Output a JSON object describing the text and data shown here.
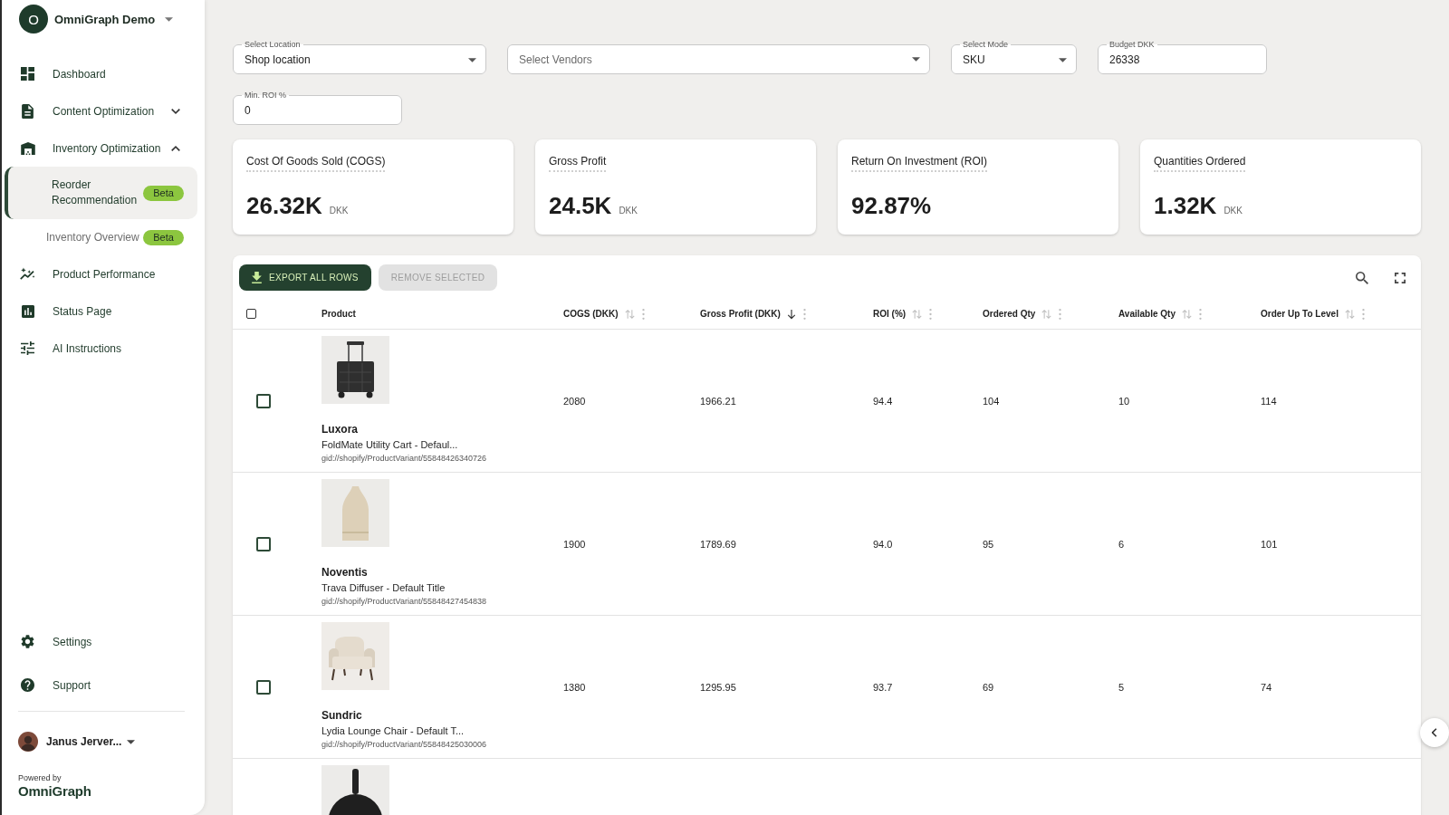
{
  "sidebar": {
    "account": {
      "initial": "O",
      "name": "OmniGraph Demo"
    },
    "nav": [
      {
        "label": "Dashboard",
        "selected": false
      },
      {
        "label": "Content Optimization",
        "selected": false,
        "expanded": false
      },
      {
        "label": "Inventory Optimization",
        "selected": false,
        "expanded": true,
        "children": [
          {
            "label": "Reorder Recommendation",
            "selected": true,
            "badge": "Beta"
          },
          {
            "label": "Inventory Overview",
            "selected": false,
            "badge": "Beta"
          }
        ]
      },
      {
        "label": "Product Performance",
        "selected": false
      },
      {
        "label": "Status Page",
        "selected": false
      },
      {
        "label": "AI Instructions",
        "selected": false
      }
    ],
    "footer_nav": [
      {
        "label": "Settings",
        "selected": false
      },
      {
        "label": "Support",
        "selected": false
      }
    ],
    "user": {
      "name": "Janus Jerver..."
    },
    "powered_by": {
      "label": "Powered by",
      "logo": "OmniGraph"
    }
  },
  "filters": [
    {
      "kind": "select",
      "label": "Select Location",
      "value": "Shop location"
    },
    {
      "kind": "select",
      "placeholder": "Select Vendors"
    },
    {
      "kind": "select",
      "label": "Select Mode",
      "value": "SKU"
    },
    {
      "kind": "input",
      "label": "Budget DKK",
      "value": "26338"
    },
    {
      "kind": "input",
      "label": "Min. ROI %",
      "value": "0"
    }
  ],
  "kpis": [
    {
      "label": "Cost Of Goods Sold (COGS)",
      "value": "26.32K",
      "unit": "DKK"
    },
    {
      "label": "Gross Profit",
      "value": "24.5K",
      "unit": "DKK"
    },
    {
      "label": "Return On Investment (ROI)",
      "value": "92.87%"
    },
    {
      "label": "Quantities Ordered",
      "value": "1.32K",
      "unit": "DKK"
    }
  ],
  "table": {
    "buttons": [
      {
        "kind": "export",
        "label": "EXPORT ALL ROWS",
        "disabled": false
      },
      {
        "kind": "remove",
        "label": "REMOVE SELECTED",
        "disabled": true
      }
    ],
    "select_all": {
      "checked": false
    },
    "columns": [
      {
        "label": "Product"
      },
      {
        "label": "COGS (DKK)",
        "sorted": false
      },
      {
        "label": "Gross Profit (DKK)",
        "sorted": true
      },
      {
        "label": "ROI (%)",
        "sorted": false
      },
      {
        "label": "Ordered Qty",
        "sorted": false
      },
      {
        "label": "Available Qty",
        "sorted": false
      },
      {
        "label": "Order Up To Level",
        "sorted": false
      }
    ],
    "rows": [
      {
        "checked": false,
        "image": {
          "kind": "cart"
        },
        "brand": "Luxora",
        "title": "FoldMate Utility Cart - Defaul...",
        "gid": "gid://shopify/ProductVariant/55848426340726",
        "cells": [
          "2080",
          "1966.21",
          "94.4",
          "104",
          "10",
          "114"
        ]
      },
      {
        "checked": false,
        "image": {
          "kind": "bottle"
        },
        "brand": "Noventis",
        "title": "Trava Diffuser - Default Title",
        "gid": "gid://shopify/ProductVariant/55848427454838",
        "cells": [
          "1900",
          "1789.69",
          "94.0",
          "95",
          "6",
          "101"
        ]
      },
      {
        "checked": false,
        "image": {
          "kind": "armchair"
        },
        "brand": "Sundric",
        "title": "Lydia Lounge Chair - Default T...",
        "gid": "gid://shopify/ProductVariant/55848425030006",
        "cells": [
          "1380",
          "1295.95",
          "93.7",
          "69",
          "5",
          "74"
        ]
      },
      {
        "image": {
          "kind": "skillet"
        }
      }
    ]
  }
}
